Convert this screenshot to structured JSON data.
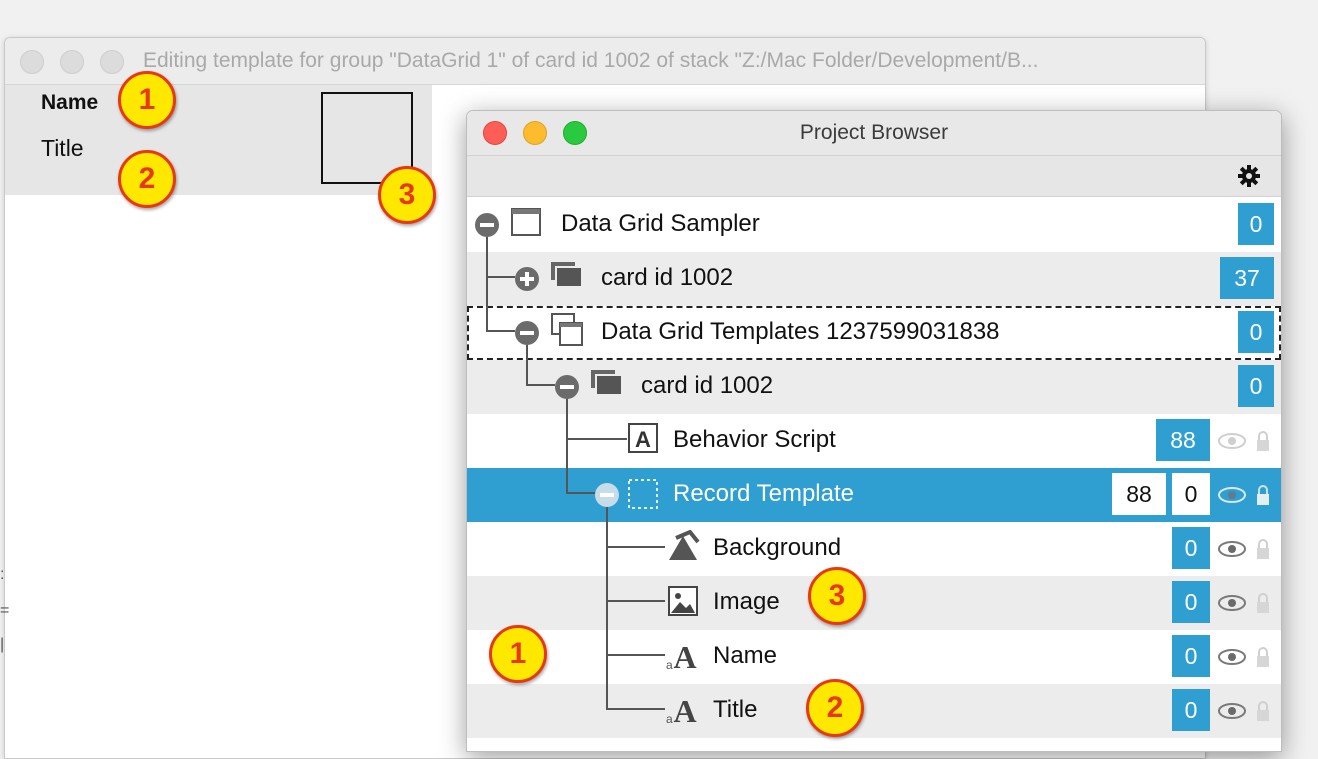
{
  "background_window": {
    "title": "Editing template for group \"DataGrid 1\" of card id 1002 of stack \"Z:/Mac Folder/Development/B...",
    "template_name_label": "Name",
    "template_title_label": "Title"
  },
  "project_browser": {
    "title": "Project Browser",
    "rows": [
      {
        "label": "Data Grid Sampler",
        "count": "0"
      },
      {
        "label": "card id 1002",
        "count": "37"
      },
      {
        "label": "Data Grid Templates 1237599031838",
        "count": "0"
      },
      {
        "label": "card id 1002",
        "count": "0"
      },
      {
        "label": "Behavior Script",
        "count": "88"
      },
      {
        "label": "Record Template",
        "count": "88",
        "count2": "0"
      },
      {
        "label": "Background",
        "count": "0"
      },
      {
        "label": "Image",
        "count": "0"
      },
      {
        "label": "Name",
        "count": "0"
      },
      {
        "label": "Title",
        "count": "0"
      }
    ]
  },
  "callouts": [
    "1",
    "2",
    "3",
    "3",
    "1",
    "2"
  ],
  "colors": {
    "selection": "#2f9ed0",
    "callout_fill": "#ffe800",
    "callout_border": "#e8380f"
  },
  "icons": [
    "gear-icon",
    "stack-icon",
    "card-icon",
    "group-icon",
    "script-icon",
    "template-group-icon",
    "graphic-icon",
    "image-icon",
    "field-icon",
    "visibility-eye-icon",
    "lock-icon"
  ]
}
